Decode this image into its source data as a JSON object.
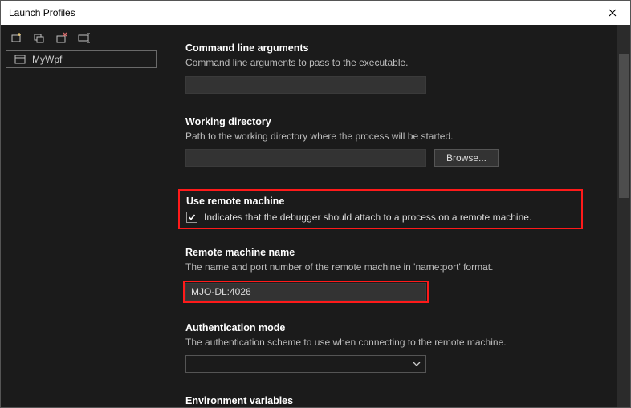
{
  "window": {
    "title": "Launch Profiles"
  },
  "sidebar": {
    "profiles": [
      {
        "label": "MyWpf"
      }
    ]
  },
  "sections": {
    "cmdArgs": {
      "title": "Command line arguments",
      "desc": "Command line arguments to pass to the executable.",
      "value": ""
    },
    "workDir": {
      "title": "Working directory",
      "desc": "Path to the working directory where the process will be started.",
      "value": "",
      "browse": "Browse..."
    },
    "remote": {
      "title": "Use remote machine",
      "checkboxLabel": "Indicates that the debugger should attach to a process on a remote machine.",
      "checked": true
    },
    "remoteName": {
      "title": "Remote machine name",
      "desc": "The name and port number of the remote machine in 'name:port' format.",
      "value": "MJO-DL:4026"
    },
    "auth": {
      "title": "Authentication mode",
      "desc": "The authentication scheme to use when connecting to the remote machine.",
      "value": ""
    },
    "env": {
      "title": "Environment variables"
    }
  }
}
